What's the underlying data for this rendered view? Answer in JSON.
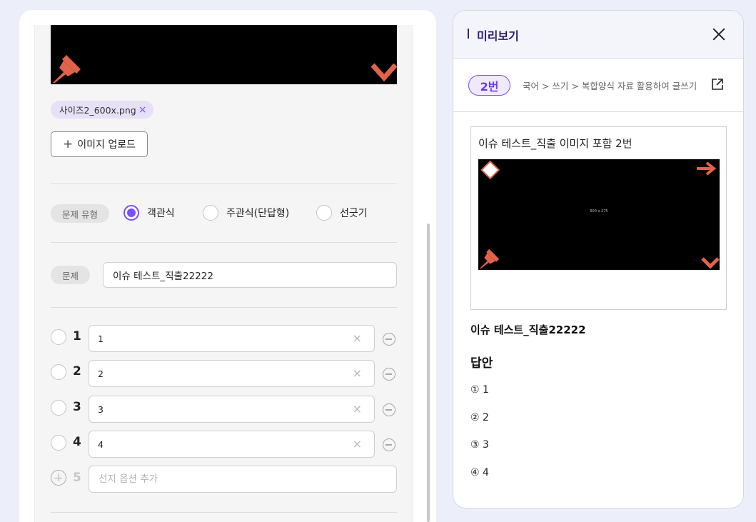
{
  "editor": {
    "file_chip": {
      "name": "사이즈2_600x.png",
      "remove": "×"
    },
    "upload_button": {
      "icon": "+",
      "label": "이미지 업로드"
    },
    "question_type": {
      "label": "문제 유형",
      "options": [
        {
          "label": "객관식",
          "selected": true
        },
        {
          "label": "주관식(단답형)",
          "selected": false
        },
        {
          "label": "선긋기",
          "selected": false
        }
      ]
    },
    "question": {
      "label": "문제",
      "value": "이슈 테스트_직출22222"
    },
    "choices": [
      {
        "num": "1",
        "value": "1"
      },
      {
        "num": "2",
        "value": "2"
      },
      {
        "num": "3",
        "value": "3"
      },
      {
        "num": "4",
        "value": "4"
      }
    ],
    "add_choice": {
      "num": "5",
      "placeholder": "선지 옵션 추가"
    },
    "clear_glyph": "×"
  },
  "preview": {
    "title": "미리보기",
    "badge": "2번",
    "path": "국어 > 쓰기 > 복합양식 자료 활용하여 글쓰기",
    "box_title": "이슈 테스트_직출 이미지 포함 2번",
    "image_label": "600 x 275",
    "question_text": "이슈 테스트_직출22222",
    "answer_title": "답안",
    "answers": [
      "① 1",
      "② 2",
      "③ 3",
      "④ 4"
    ]
  },
  "colors": {
    "accent": "#7b4dff",
    "pin": "#e0634a",
    "header_text": "#2a1c6b"
  },
  "icons": [
    "pin-icon",
    "chevron-down-icon",
    "arrow-right-icon",
    "close-icon",
    "external-link-icon",
    "clear-icon",
    "minus-circle-icon",
    "plus-circle-icon"
  ]
}
